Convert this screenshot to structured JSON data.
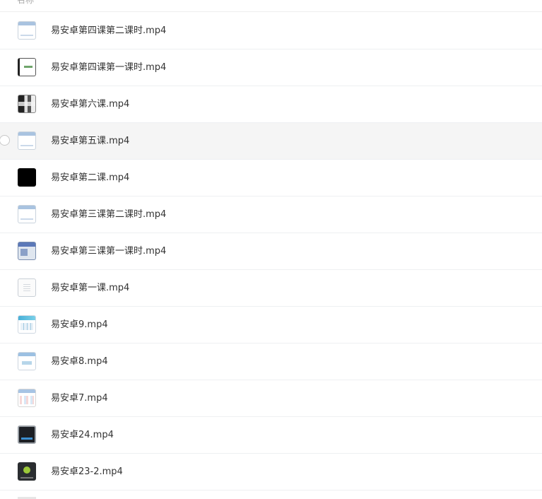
{
  "header": {
    "label": "名称",
    "sort_icon": "chevron-down-icon"
  },
  "hovered_index": 3,
  "files": [
    {
      "name": "易安卓第四课第二课时.mp4",
      "thumb": "video-thumbnail"
    },
    {
      "name": "易安卓第四课第一课时.mp4",
      "thumb": "video-thumbnail"
    },
    {
      "name": "易安卓第六课.mp4",
      "thumb": "video-thumbnail"
    },
    {
      "name": "易安卓第五课.mp4",
      "thumb": "video-thumbnail"
    },
    {
      "name": "易安卓第二课.mp4",
      "thumb": "video-thumbnail"
    },
    {
      "name": "易安卓第三课第二课时.mp4",
      "thumb": "video-thumbnail"
    },
    {
      "name": "易安卓第三课第一课时.mp4",
      "thumb": "video-thumbnail"
    },
    {
      "name": "易安卓第一课.mp4",
      "thumb": "video-thumbnail"
    },
    {
      "name": "易安卓9.mp4",
      "thumb": "video-thumbnail"
    },
    {
      "name": "易安卓8.mp4",
      "thumb": "video-thumbnail"
    },
    {
      "name": "易安卓7.mp4",
      "thumb": "video-thumbnail"
    },
    {
      "name": "易安卓24.mp4",
      "thumb": "video-thumbnail"
    },
    {
      "name": "易安卓23-2.mp4",
      "thumb": "video-thumbnail"
    }
  ]
}
